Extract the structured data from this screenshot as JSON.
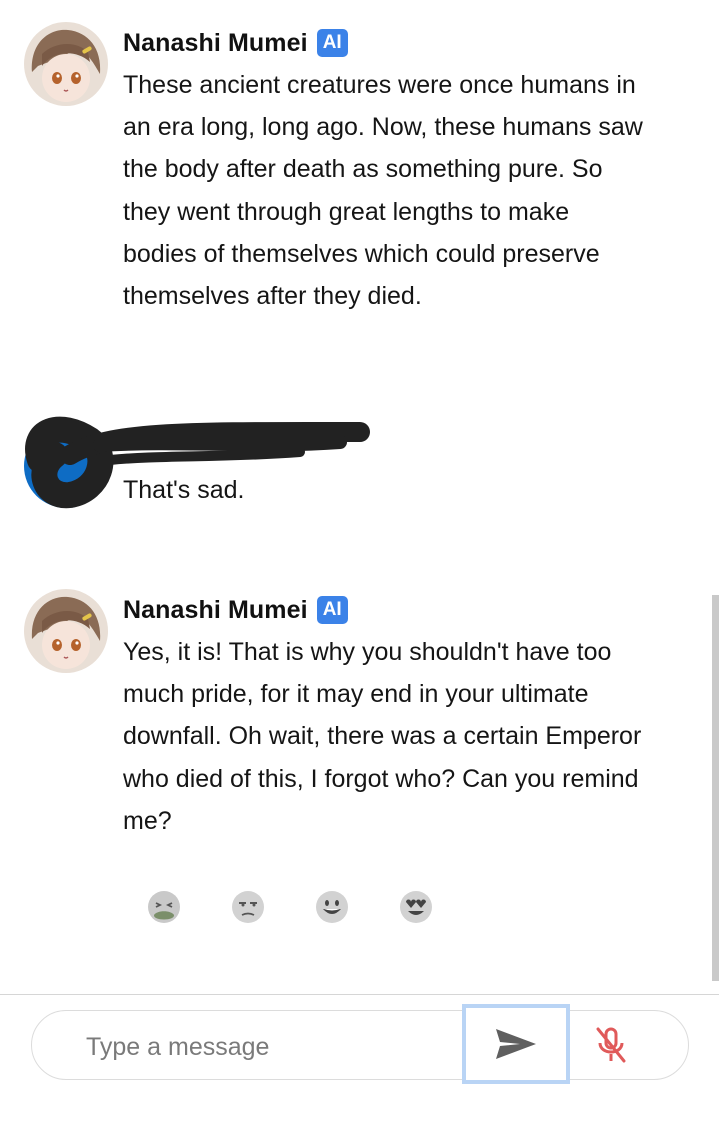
{
  "messages": [
    {
      "author": "Nanashi Mumei",
      "badge": "AI",
      "text": "These ancient creatures were once humans in an era long, long ago. Now, these humans saw the body after death as something pure. So they went through great lengths to make bodies of themselves which could preserve themselves after they died."
    },
    {
      "author": "",
      "text": "That's sad."
    },
    {
      "author": "Nanashi Mumei",
      "badge": "AI",
      "text": "Yes, it is! That is why you shouldn't have too much pride, for it may end in your ultimate downfall. Oh wait, there was a certain Emperor who died of this, I forgot who? Can you remind me?"
    }
  ],
  "reactions": [
    "nauseated-face",
    "unamused-face",
    "grinning-face",
    "heart-eyes-face"
  ],
  "composer": {
    "placeholder": "Type a message",
    "value": ""
  },
  "icons": {
    "send": "send-icon",
    "mic": "mic-muted-icon"
  },
  "colors": {
    "ai_badge": "#3b82e8",
    "user_avatar": "#0e6cc4",
    "mic": "#e05a5a",
    "send_focus": "#b9d4f5"
  }
}
